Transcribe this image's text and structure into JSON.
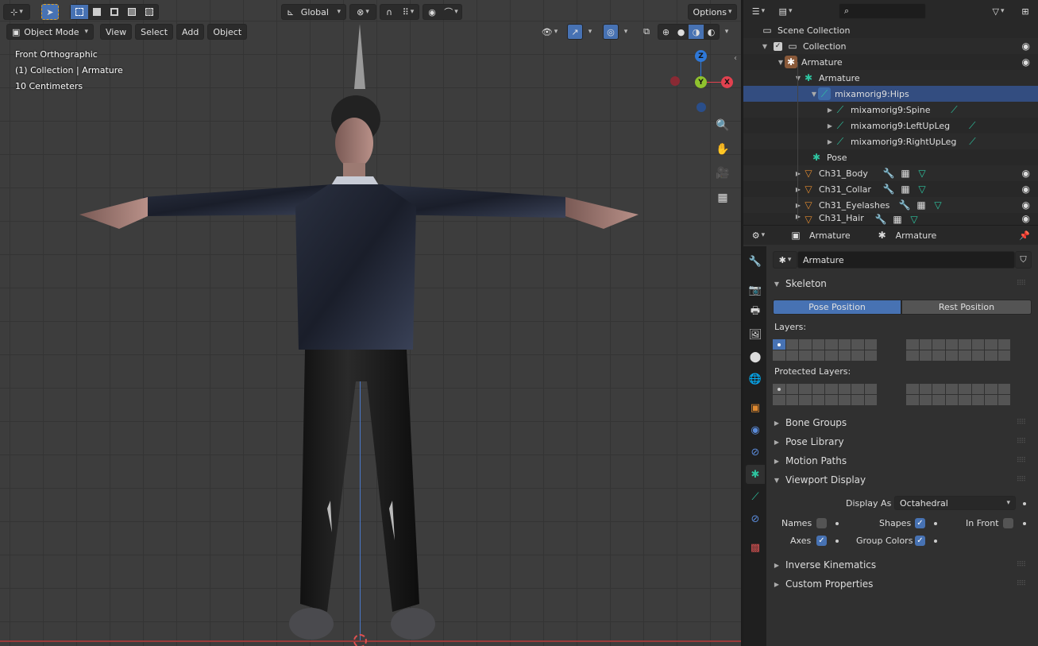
{
  "viewport": {
    "header": {
      "transform_orientation": "Global",
      "options_label": "Options"
    },
    "header2": {
      "mode": "Object Mode",
      "menus": [
        "View",
        "Select",
        "Add",
        "Object"
      ]
    },
    "overlay": {
      "view_name": "Front Orthographic",
      "collection_info": "(1) Collection | Armature",
      "scale": "10 Centimeters"
    },
    "gizmo": {
      "z": "Z",
      "y": "Y",
      "x": "X"
    },
    "icons": {
      "zoom": "zoom-icon",
      "pan": "hand-icon",
      "camera": "camera-icon",
      "grid": "grid-icon"
    }
  },
  "outliner": {
    "scene_collection": "Scene Collection",
    "rows": [
      {
        "label": "Collection"
      },
      {
        "label": "Armature"
      },
      {
        "label": "Armature"
      },
      {
        "label": "mixamorig9:Hips"
      },
      {
        "label": "mixamorig9:Spine"
      },
      {
        "label": "mixamorig9:LeftUpLeg"
      },
      {
        "label": "mixamorig9:RightUpLeg"
      },
      {
        "label": "Pose"
      },
      {
        "label": "Ch31_Body"
      },
      {
        "label": "Ch31_Collar"
      },
      {
        "label": "Ch31_Eyelashes"
      },
      {
        "label": "Ch31_Hair"
      }
    ]
  },
  "properties": {
    "breadcrumb": {
      "object": "Armature",
      "data": "Armature"
    },
    "datablock_name": "Armature",
    "skeleton": {
      "title": "Skeleton",
      "pose_position": "Pose Position",
      "rest_position": "Rest Position",
      "layers_label": "Layers:",
      "protected_label": "Protected Layers:"
    },
    "panels": {
      "bone_groups": "Bone Groups",
      "pose_library": "Pose Library",
      "motion_paths": "Motion Paths",
      "viewport_display": "Viewport Display",
      "inverse_kinematics": "Inverse Kinematics",
      "custom_properties": "Custom Properties"
    },
    "viewport_display": {
      "display_as_label": "Display As",
      "display_as_value": "Octahedral",
      "names": "Names",
      "shapes": "Shapes",
      "in_front": "In Front",
      "axes": "Axes",
      "group_colors": "Group Colors",
      "names_checked": false,
      "shapes_checked": true,
      "in_front_checked": false,
      "axes_checked": true,
      "group_colors_checked": true
    }
  }
}
